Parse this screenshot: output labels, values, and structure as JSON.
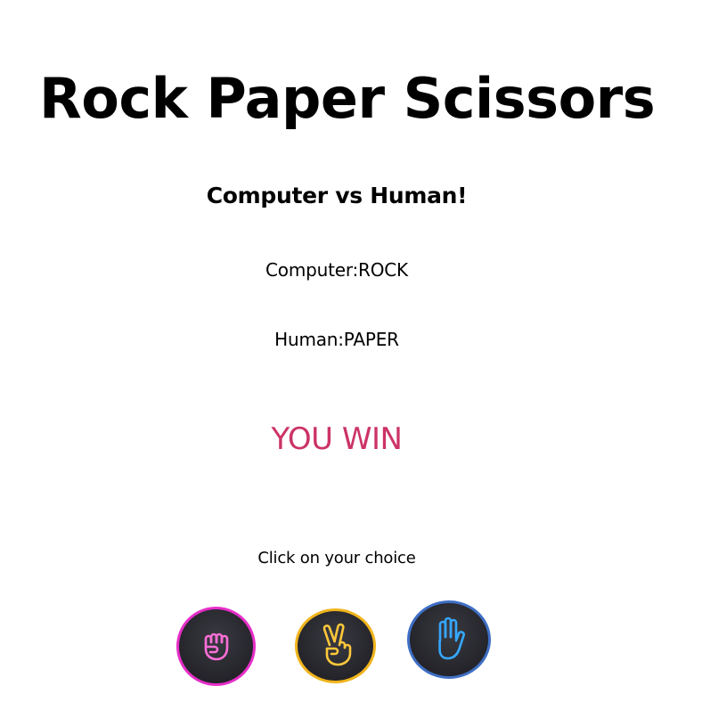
{
  "game": {
    "title": "Rock Paper Scissors",
    "subtitle": "Computer vs Human!",
    "computer_choice": "Computer:ROCK",
    "human_choice": "Human:PAPER",
    "result": "YOU WIN",
    "prompt": "Click on your choice"
  },
  "choices": [
    {
      "name": "rock",
      "icon": "fist-icon",
      "accent": "#e62ec8"
    },
    {
      "name": "scissors",
      "icon": "peace-hand-icon",
      "accent": "#f0b41c"
    },
    {
      "name": "paper",
      "icon": "open-hand-icon",
      "accent": "#3f6fc4"
    }
  ],
  "colors": {
    "result": "#cc3366",
    "background": "#ffffff",
    "text": "#000000"
  }
}
